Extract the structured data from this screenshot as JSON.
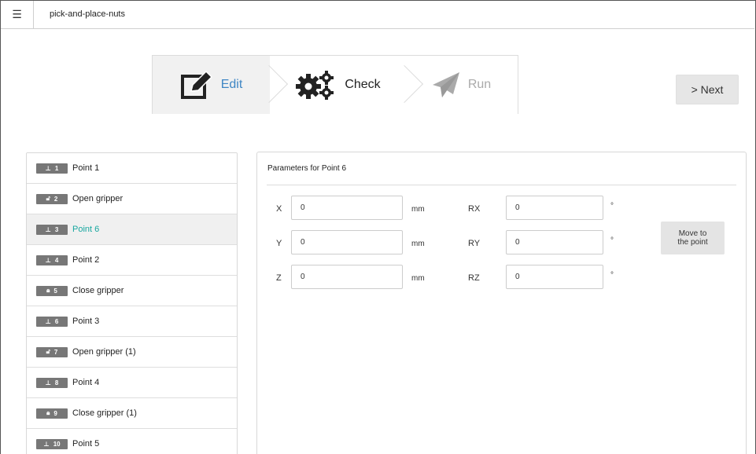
{
  "app": {
    "title": "pick-and-place-nuts",
    "menu_icon": "☰"
  },
  "steps": [
    {
      "label": "Edit",
      "icon": "edit-icon"
    },
    {
      "label": "Check",
      "icon": "gears-icon"
    },
    {
      "label": "Run",
      "icon": "paper-plane-icon"
    }
  ],
  "next_button": "> Next",
  "program_items": [
    {
      "num": "1",
      "icon": "pin-icon",
      "label": "Point 1"
    },
    {
      "num": "2",
      "icon": "unlock-icon",
      "label": "Open gripper"
    },
    {
      "num": "3",
      "icon": "pin-icon",
      "label": "Point 6"
    },
    {
      "num": "4",
      "icon": "pin-icon",
      "label": "Point 2"
    },
    {
      "num": "5",
      "icon": "lock-icon",
      "label": "Close gripper"
    },
    {
      "num": "6",
      "icon": "pin-icon",
      "label": "Point 3"
    },
    {
      "num": "7",
      "icon": "unlock-icon",
      "label": "Open gripper (1)"
    },
    {
      "num": "8",
      "icon": "pin-icon",
      "label": "Point 4"
    },
    {
      "num": "9",
      "icon": "lock-icon",
      "label": "Close gripper (1)"
    },
    {
      "num": "10",
      "icon": "pin-icon",
      "label": "Point 5"
    }
  ],
  "params": {
    "title": "Parameters for  Point 6",
    "x": {
      "label": "X",
      "value": "0",
      "unit": "mm"
    },
    "y": {
      "label": "Y",
      "value": "0",
      "unit": "mm"
    },
    "z": {
      "label": "Z",
      "value": "0",
      "unit": "mm"
    },
    "rx": {
      "label": "RX",
      "value": "0",
      "unit": "°"
    },
    "ry": {
      "label": "RY",
      "value": "0",
      "unit": "°"
    },
    "rz": {
      "label": "RZ",
      "value": "0",
      "unit": "°"
    },
    "move_button_line1": "Move to",
    "move_button_line2": "the point"
  },
  "colors": {
    "accent_blue": "#3e86c4",
    "active_teal": "#17a7a0",
    "badge_gray": "#777777"
  }
}
